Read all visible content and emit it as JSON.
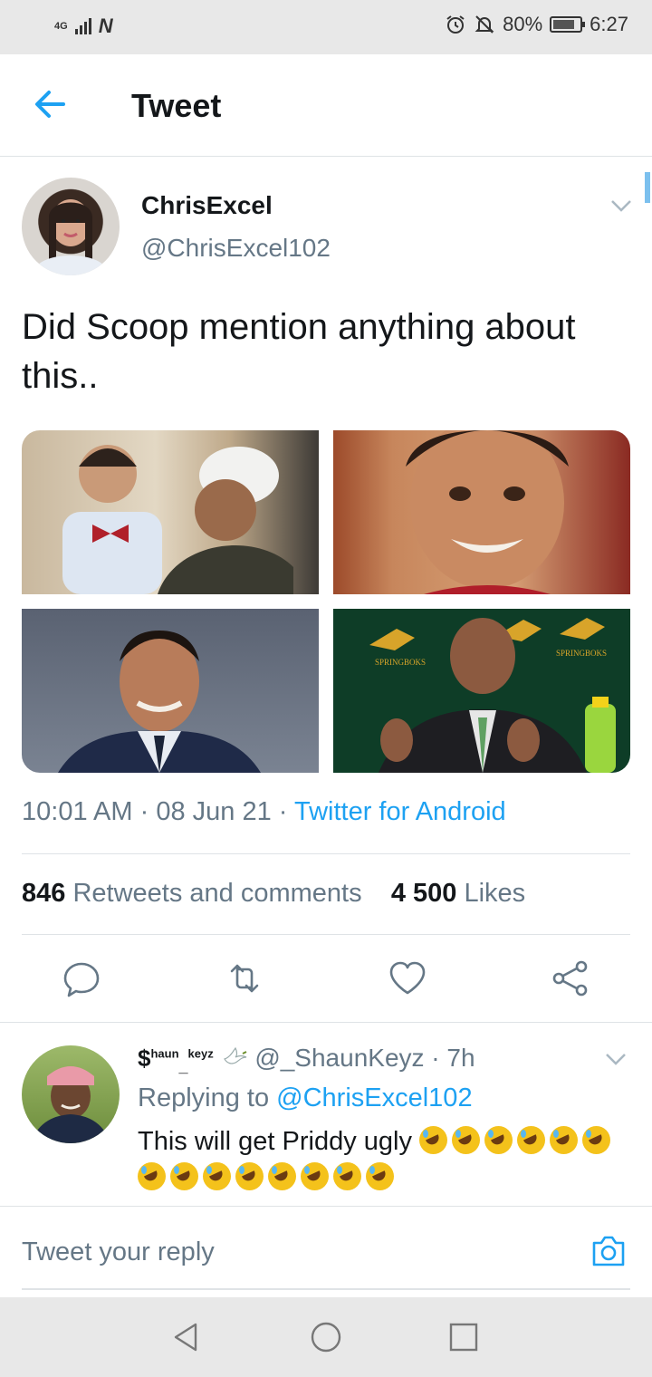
{
  "status_bar": {
    "network": "4G",
    "carrier_icon": "N",
    "battery": "80%",
    "battery_level": 0.8,
    "time": "6:27"
  },
  "app_bar": {
    "title": "Tweet"
  },
  "tweet": {
    "author_name": "ChrisExcel",
    "author_handle": "@ChrisExcel102",
    "text": "Did Scoop mention anything about this..",
    "media_count": 4,
    "time": "10:01 AM",
    "date": "08 Jun 21",
    "source": "Twitter for Android",
    "sep": " · ",
    "retweets_count": "846",
    "retweets_label": "Retweets and comments",
    "likes_count": "4 500",
    "likes_label": "Likes"
  },
  "reply": {
    "display_name_part1": "$",
    "display_name_sup1": "haun",
    "display_name_sub": "_",
    "display_name_sup2": "keyz",
    "handle": "@_ShaunKeyz",
    "age": "7h",
    "replying_prefix": "Replying to",
    "replying_to": "@ChrisExcel102",
    "text": "This will get Priddy ugly",
    "emoji_count": 14,
    "emoji": "rolling-on-floor-laughing"
  },
  "composer": {
    "placeholder": "Tweet your reply"
  },
  "colors": {
    "accent": "#1da1f2",
    "secondary_text": "#657786",
    "primary_text": "#14171a",
    "divider": "#dfe3e6"
  }
}
